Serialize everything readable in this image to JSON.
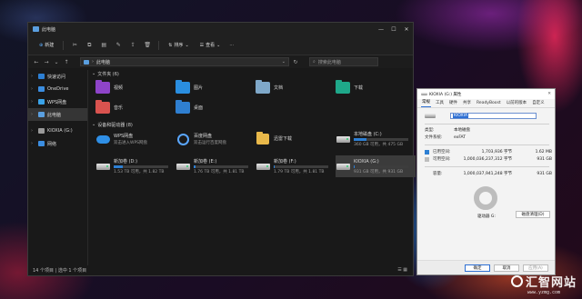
{
  "explorer": {
    "title": "此电脑",
    "toolbar": {
      "new_label": "新建",
      "sort_label": "排序",
      "view_label": "查看",
      "more": "···"
    },
    "address": {
      "crumb": "此电脑",
      "refresh": "↻",
      "search_placeholder": "搜索此电脑"
    },
    "nav": [
      {
        "label": "快速访问",
        "color": "#2d7fd3",
        "expandable": true
      },
      {
        "label": "OneDrive",
        "color": "#3b8de0",
        "expandable": true
      },
      {
        "label": "WPS网盘",
        "color": "#3aa3e8",
        "expandable": true
      },
      {
        "label": "此电脑",
        "color": "#5a9fe0",
        "expandable": true,
        "active": true
      },
      {
        "label": "KIOXIA (G:)",
        "color": "#9a9a9a",
        "expandable": true
      },
      {
        "label": "网络",
        "color": "#3b8de0",
        "expandable": true
      }
    ],
    "folders_header": "文件夹 (6)",
    "folders": [
      {
        "label": "视频",
        "color": "#8e44c9"
      },
      {
        "label": "图片",
        "color": "#2a8ee0"
      },
      {
        "label": "文档",
        "color": "#7fa8c9"
      },
      {
        "label": "下载",
        "color": "#1fa88a"
      },
      {
        "label": "音乐",
        "color": "#d9534f"
      },
      {
        "label": "桌面",
        "color": "#2f7fd0"
      }
    ],
    "drives_header": "设备和驱动器 (8)",
    "drives": [
      {
        "name": "WPS网盘",
        "sub": "双击进入WPS网盘",
        "used": null,
        "icon": "cloud"
      },
      {
        "name": "百度网盘",
        "sub": "双击运行百度网盘",
        "used": null,
        "icon": "baidu"
      },
      {
        "name": "迅雷下载",
        "sub": "",
        "used": null,
        "icon": "folder"
      },
      {
        "name": "本地磁盘 (C:)",
        "sub": "360 GB 可用，共 475 GB",
        "used": 0.24,
        "icon": "hdd"
      },
      {
        "name": "新加卷 (D:)",
        "sub": "1.53 TB 可用，共 1.82 TB",
        "used": 0.16,
        "icon": "hdd"
      },
      {
        "name": "新加卷 (E:)",
        "sub": "1.76 TB 可用，共 1.81 TB",
        "used": 0.03,
        "icon": "hdd"
      },
      {
        "name": "新加卷 (F:)",
        "sub": "1.79 TB 可用，共 1.81 TB",
        "used": 0.01,
        "icon": "hdd"
      },
      {
        "name": "KIOXIA (G:)",
        "sub": "931 GB 可用，共 931 GB",
        "used": 0.003,
        "icon": "hdd",
        "selected": true
      }
    ],
    "status": "14 个项目  |  选中 1 个项目"
  },
  "props": {
    "title": "KIOXIA (G:) 属性",
    "tabs": [
      "常规",
      "工具",
      "硬件",
      "共享",
      "ReadyBoost",
      "以前的版本",
      "自定义"
    ],
    "name_value": "KIOXIA",
    "type_label": "类型:",
    "type_value": "本地磁盘",
    "fs_label": "文件系统:",
    "fs_value": "exFAT",
    "used_label": "已用空间:",
    "used_bytes": "1,703,936 字节",
    "used_size": "1.62 MB",
    "free_label": "可用空间:",
    "free_bytes": "1,000,036,237,312 字节",
    "free_size": "931 GB",
    "cap_label": "容量:",
    "cap_bytes": "1,000,037,941,248 字节",
    "cap_size": "931 GB",
    "used_color": "#2d7fd3",
    "free_color": "#bdbdbd",
    "drive_label": "驱动器 G:",
    "cleanup_button": "磁盘清理(D)",
    "ok_button": "确定",
    "cancel_button": "取消",
    "apply_button": "应用(A)"
  },
  "watermark": {
    "text": "汇智网站",
    "url": "www.yzmg.com"
  }
}
